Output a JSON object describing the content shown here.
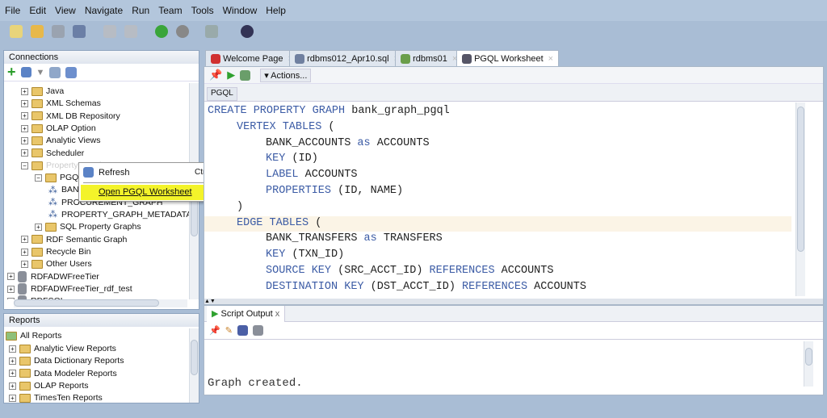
{
  "menu": [
    "File",
    "Edit",
    "View",
    "Navigate",
    "Run",
    "Team",
    "Tools",
    "Window",
    "Help"
  ],
  "connections": {
    "title": "Connections",
    "tree": [
      {
        "label": "Java",
        "level": 1,
        "icon": "java-folder-icon"
      },
      {
        "label": "XML Schemas",
        "level": 1,
        "icon": "xml-folder-icon"
      },
      {
        "label": "XML DB Repository",
        "level": 1,
        "icon": "xmldb-folder-icon"
      },
      {
        "label": "OLAP Option",
        "level": 1,
        "icon": "olap-folder-icon"
      },
      {
        "label": "Analytic Views",
        "level": 1,
        "icon": "analytic-folder-icon"
      },
      {
        "label": "Scheduler",
        "level": 1,
        "icon": "scheduler-folder-icon"
      },
      {
        "label": "Property Graph",
        "level": 1,
        "icon": "property-graph-folder-icon"
      },
      {
        "label": "PGQL",
        "level": 2,
        "icon": "graph-folder-icon"
      },
      {
        "label": "BANK_GRAPH",
        "level": 3,
        "icon": "graph-icon"
      },
      {
        "label": "PROCUREMENT_GRAPH",
        "level": 3,
        "icon": "graph-icon"
      },
      {
        "label": "PROPERTY_GRAPH_METADATA",
        "level": 3,
        "icon": "graph-icon"
      },
      {
        "label": "SQL Property Graphs",
        "level": 2,
        "icon": "graph-folder-icon"
      },
      {
        "label": "RDF Semantic Graph",
        "level": 1,
        "icon": "rdf-folder-icon"
      },
      {
        "label": "Recycle Bin",
        "level": 1,
        "icon": "trash-icon"
      },
      {
        "label": "Other Users",
        "level": 1,
        "icon": "users-folder-icon"
      },
      {
        "label": "RDFADWFreeTier",
        "level": 0,
        "icon": "database-icon"
      },
      {
        "label": "RDFADWFreeTier_rdf_test",
        "level": 0,
        "icon": "database-icon"
      },
      {
        "label": "RDFSQL",
        "level": 0,
        "icon": "database-icon"
      }
    ]
  },
  "context_menu": {
    "items": [
      {
        "label": "Refresh",
        "shortcut": "Ctrl-R"
      },
      {
        "label": "Open PGQL Worksheet",
        "shortcut": ""
      }
    ]
  },
  "reports": {
    "title": "Reports",
    "root": "All Reports",
    "items": [
      "Analytic View Reports",
      "Data Dictionary Reports",
      "Data Modeler Reports",
      "OLAP Reports",
      "TimesTen Reports"
    ]
  },
  "tabs": [
    "Welcome Page",
    "rdbms012_Apr10.sql",
    "rdbms01",
    "PGQL Worksheet"
  ],
  "editor": {
    "actions": "Actions...",
    "subtab": "PGQL",
    "lines": [
      [
        0,
        [
          [
            "k",
            "CREATE PROPERTY GRAPH "
          ],
          [
            "n",
            "bank_graph_pgql"
          ]
        ]
      ],
      [
        1,
        [
          [
            "k",
            "VERTEX TABLES "
          ],
          [
            "n",
            "("
          ]
        ]
      ],
      [
        2,
        [
          [
            "n",
            "BANK_ACCOUNTS "
          ],
          [
            "k",
            "as "
          ],
          [
            "n",
            "ACCOUNTS"
          ]
        ]
      ],
      [
        2,
        [
          [
            "k",
            "KEY "
          ],
          [
            "n",
            "(ID)"
          ]
        ]
      ],
      [
        2,
        [
          [
            "k",
            "LABEL "
          ],
          [
            "n",
            "ACCOUNTS"
          ]
        ]
      ],
      [
        2,
        [
          [
            "k",
            "PROPERTIES "
          ],
          [
            "n",
            "(ID, NAME)"
          ]
        ]
      ],
      [
        1,
        [
          [
            "n",
            ")"
          ]
        ]
      ],
      [
        1,
        [
          [
            "k",
            "EDGE TABLES "
          ],
          [
            "n",
            "("
          ]
        ]
      ],
      [
        2,
        [
          [
            "n",
            "BANK_TRANSFERS "
          ],
          [
            "k",
            "as "
          ],
          [
            "n",
            "TRANSFERS"
          ]
        ]
      ],
      [
        2,
        [
          [
            "k",
            "KEY "
          ],
          [
            "n",
            "(TXN_ID)"
          ]
        ]
      ],
      [
        2,
        [
          [
            "k",
            "SOURCE KEY "
          ],
          [
            "n",
            "(SRC_ACCT_ID) "
          ],
          [
            "k",
            "REFERENCES "
          ],
          [
            "n",
            "ACCOUNTS"
          ]
        ]
      ],
      [
        2,
        [
          [
            "k",
            "DESTINATION KEY "
          ],
          [
            "n",
            "(DST_ACCT_ID) "
          ],
          [
            "k",
            "REFERENCES "
          ],
          [
            "n",
            "ACCOUNTS"
          ]
        ]
      ]
    ]
  },
  "output": {
    "tab": "Script Output",
    "text": "Graph created."
  }
}
